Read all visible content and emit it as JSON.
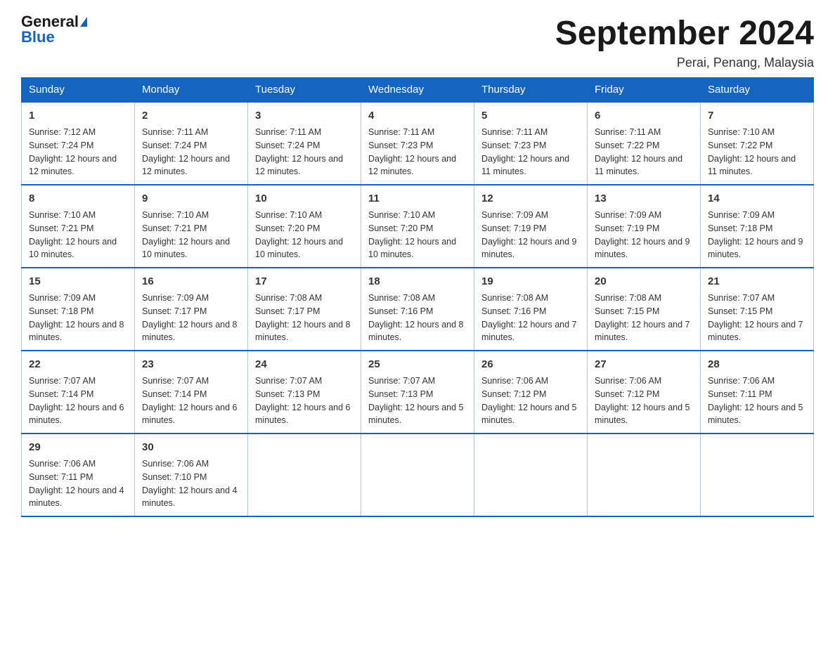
{
  "header": {
    "logo_general": "General",
    "logo_blue": "Blue",
    "month_title": "September 2024",
    "location": "Perai, Penang, Malaysia"
  },
  "weekdays": [
    "Sunday",
    "Monday",
    "Tuesday",
    "Wednesday",
    "Thursday",
    "Friday",
    "Saturday"
  ],
  "weeks": [
    [
      {
        "day": "1",
        "sunrise": "Sunrise: 7:12 AM",
        "sunset": "Sunset: 7:24 PM",
        "daylight": "Daylight: 12 hours and 12 minutes."
      },
      {
        "day": "2",
        "sunrise": "Sunrise: 7:11 AM",
        "sunset": "Sunset: 7:24 PM",
        "daylight": "Daylight: 12 hours and 12 minutes."
      },
      {
        "day": "3",
        "sunrise": "Sunrise: 7:11 AM",
        "sunset": "Sunset: 7:24 PM",
        "daylight": "Daylight: 12 hours and 12 minutes."
      },
      {
        "day": "4",
        "sunrise": "Sunrise: 7:11 AM",
        "sunset": "Sunset: 7:23 PM",
        "daylight": "Daylight: 12 hours and 12 minutes."
      },
      {
        "day": "5",
        "sunrise": "Sunrise: 7:11 AM",
        "sunset": "Sunset: 7:23 PM",
        "daylight": "Daylight: 12 hours and 11 minutes."
      },
      {
        "day": "6",
        "sunrise": "Sunrise: 7:11 AM",
        "sunset": "Sunset: 7:22 PM",
        "daylight": "Daylight: 12 hours and 11 minutes."
      },
      {
        "day": "7",
        "sunrise": "Sunrise: 7:10 AM",
        "sunset": "Sunset: 7:22 PM",
        "daylight": "Daylight: 12 hours and 11 minutes."
      }
    ],
    [
      {
        "day": "8",
        "sunrise": "Sunrise: 7:10 AM",
        "sunset": "Sunset: 7:21 PM",
        "daylight": "Daylight: 12 hours and 10 minutes."
      },
      {
        "day": "9",
        "sunrise": "Sunrise: 7:10 AM",
        "sunset": "Sunset: 7:21 PM",
        "daylight": "Daylight: 12 hours and 10 minutes."
      },
      {
        "day": "10",
        "sunrise": "Sunrise: 7:10 AM",
        "sunset": "Sunset: 7:20 PM",
        "daylight": "Daylight: 12 hours and 10 minutes."
      },
      {
        "day": "11",
        "sunrise": "Sunrise: 7:10 AM",
        "sunset": "Sunset: 7:20 PM",
        "daylight": "Daylight: 12 hours and 10 minutes."
      },
      {
        "day": "12",
        "sunrise": "Sunrise: 7:09 AM",
        "sunset": "Sunset: 7:19 PM",
        "daylight": "Daylight: 12 hours and 9 minutes."
      },
      {
        "day": "13",
        "sunrise": "Sunrise: 7:09 AM",
        "sunset": "Sunset: 7:19 PM",
        "daylight": "Daylight: 12 hours and 9 minutes."
      },
      {
        "day": "14",
        "sunrise": "Sunrise: 7:09 AM",
        "sunset": "Sunset: 7:18 PM",
        "daylight": "Daylight: 12 hours and 9 minutes."
      }
    ],
    [
      {
        "day": "15",
        "sunrise": "Sunrise: 7:09 AM",
        "sunset": "Sunset: 7:18 PM",
        "daylight": "Daylight: 12 hours and 8 minutes."
      },
      {
        "day": "16",
        "sunrise": "Sunrise: 7:09 AM",
        "sunset": "Sunset: 7:17 PM",
        "daylight": "Daylight: 12 hours and 8 minutes."
      },
      {
        "day": "17",
        "sunrise": "Sunrise: 7:08 AM",
        "sunset": "Sunset: 7:17 PM",
        "daylight": "Daylight: 12 hours and 8 minutes."
      },
      {
        "day": "18",
        "sunrise": "Sunrise: 7:08 AM",
        "sunset": "Sunset: 7:16 PM",
        "daylight": "Daylight: 12 hours and 8 minutes."
      },
      {
        "day": "19",
        "sunrise": "Sunrise: 7:08 AM",
        "sunset": "Sunset: 7:16 PM",
        "daylight": "Daylight: 12 hours and 7 minutes."
      },
      {
        "day": "20",
        "sunrise": "Sunrise: 7:08 AM",
        "sunset": "Sunset: 7:15 PM",
        "daylight": "Daylight: 12 hours and 7 minutes."
      },
      {
        "day": "21",
        "sunrise": "Sunrise: 7:07 AM",
        "sunset": "Sunset: 7:15 PM",
        "daylight": "Daylight: 12 hours and 7 minutes."
      }
    ],
    [
      {
        "day": "22",
        "sunrise": "Sunrise: 7:07 AM",
        "sunset": "Sunset: 7:14 PM",
        "daylight": "Daylight: 12 hours and 6 minutes."
      },
      {
        "day": "23",
        "sunrise": "Sunrise: 7:07 AM",
        "sunset": "Sunset: 7:14 PM",
        "daylight": "Daylight: 12 hours and 6 minutes."
      },
      {
        "day": "24",
        "sunrise": "Sunrise: 7:07 AM",
        "sunset": "Sunset: 7:13 PM",
        "daylight": "Daylight: 12 hours and 6 minutes."
      },
      {
        "day": "25",
        "sunrise": "Sunrise: 7:07 AM",
        "sunset": "Sunset: 7:13 PM",
        "daylight": "Daylight: 12 hours and 5 minutes."
      },
      {
        "day": "26",
        "sunrise": "Sunrise: 7:06 AM",
        "sunset": "Sunset: 7:12 PM",
        "daylight": "Daylight: 12 hours and 5 minutes."
      },
      {
        "day": "27",
        "sunrise": "Sunrise: 7:06 AM",
        "sunset": "Sunset: 7:12 PM",
        "daylight": "Daylight: 12 hours and 5 minutes."
      },
      {
        "day": "28",
        "sunrise": "Sunrise: 7:06 AM",
        "sunset": "Sunset: 7:11 PM",
        "daylight": "Daylight: 12 hours and 5 minutes."
      }
    ],
    [
      {
        "day": "29",
        "sunrise": "Sunrise: 7:06 AM",
        "sunset": "Sunset: 7:11 PM",
        "daylight": "Daylight: 12 hours and 4 minutes."
      },
      {
        "day": "30",
        "sunrise": "Sunrise: 7:06 AM",
        "sunset": "Sunset: 7:10 PM",
        "daylight": "Daylight: 12 hours and 4 minutes."
      },
      null,
      null,
      null,
      null,
      null
    ]
  ]
}
